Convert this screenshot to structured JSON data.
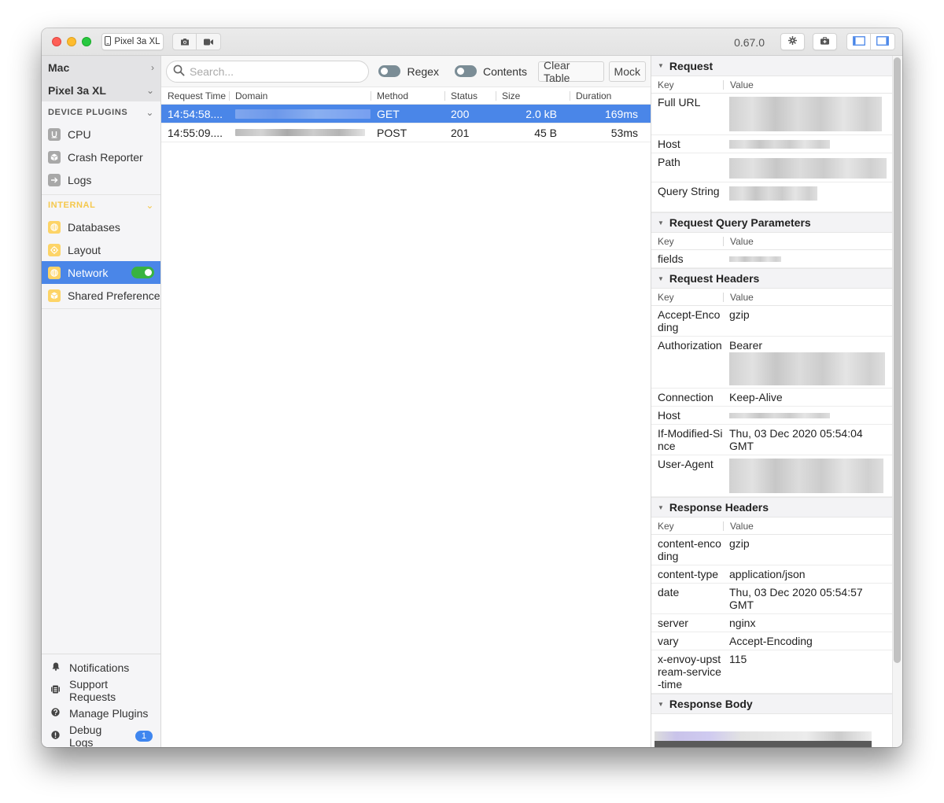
{
  "titlebar": {
    "device_button_label": "Pixel 3a XL",
    "version": "0.67.0"
  },
  "sidebar": {
    "devices": [
      {
        "label": "Mac",
        "chevron": ">"
      },
      {
        "label": "Pixel 3a XL",
        "chevron": "v"
      }
    ],
    "device_plugins": {
      "title": "DEVICE PLUGINS",
      "items": [
        {
          "label": "CPU",
          "icon": "cpu-icon"
        },
        {
          "label": "Crash Reporter",
          "icon": "cube-icon"
        },
        {
          "label": "Logs",
          "icon": "arrow-right-icon"
        }
      ]
    },
    "internal": {
      "title": "INTERNAL",
      "accent_color": "#f5c84c",
      "items": [
        {
          "label": "Databases",
          "icon": "globe-icon"
        },
        {
          "label": "Layout",
          "icon": "target-icon"
        },
        {
          "label": "Network",
          "icon": "globe-icon",
          "active": true,
          "toggle": "on"
        },
        {
          "label": "Shared Preferences",
          "icon": "cube-icon"
        }
      ]
    },
    "bottom": [
      {
        "label": "Notifications",
        "icon": "bell-icon"
      },
      {
        "label": "Support Requests",
        "icon": "clipboard-icon"
      },
      {
        "label": "Manage Plugins",
        "icon": "question-icon"
      },
      {
        "label": "Debug Logs",
        "icon": "exclamation-icon",
        "badge": "1"
      }
    ]
  },
  "toolbar": {
    "search_placeholder": "Search...",
    "regex_label": "Regex",
    "contents_label": "Contents",
    "clear_label": "Clear Table",
    "mock_label": "Mock"
  },
  "table": {
    "columns": [
      "Request Time",
      "Domain",
      "Method",
      "Status",
      "Size",
      "Duration"
    ],
    "rows": [
      {
        "time": "14:54:58....",
        "domain": "[redacted]",
        "method": "GET",
        "status": "200",
        "size": "2.0 kB",
        "duration": "169ms",
        "selected": true
      },
      {
        "time": "14:55:09....",
        "domain": "[redacted]",
        "method": "POST",
        "status": "201",
        "size": "45 B",
        "duration": "53ms",
        "selected": false
      }
    ]
  },
  "detail": {
    "key_label": "Key",
    "value_label": "Value",
    "request": {
      "title": "Request",
      "rows": [
        {
          "key": "Full URL",
          "value": ""
        },
        {
          "key": "Host",
          "value": ""
        },
        {
          "key": "Path",
          "value": ""
        },
        {
          "key": "Query String",
          "value": ""
        }
      ]
    },
    "query_params": {
      "title": "Request Query Parameters",
      "rows": [
        {
          "key": "fields",
          "value": ""
        }
      ]
    },
    "request_headers": {
      "title": "Request Headers",
      "rows": [
        {
          "key": "Accept-Encoding",
          "value": "gzip"
        },
        {
          "key": "Authorization",
          "value": "Bearer"
        },
        {
          "key": "Connection",
          "value": "Keep-Alive"
        },
        {
          "key": "Host",
          "value": ""
        },
        {
          "key": "If-Modified-Since",
          "value": "Thu, 03 Dec 2020 05:54:04 GMT"
        },
        {
          "key": "User-Agent",
          "value": ""
        }
      ]
    },
    "response_headers": {
      "title": "Response Headers",
      "rows": [
        {
          "key": "content-encoding",
          "value": "gzip"
        },
        {
          "key": "content-type",
          "value": "application/json"
        },
        {
          "key": "date",
          "value": "Thu, 03 Dec 2020 05:54:57 GMT"
        },
        {
          "key": "server",
          "value": "nginx"
        },
        {
          "key": "vary",
          "value": "Accept-Encoding"
        },
        {
          "key": "x-envoy-upstream-service-time",
          "value": "115"
        }
      ]
    },
    "response_body": {
      "title": "Response Body"
    }
  },
  "colors": {
    "selection": "#4a86e8",
    "toggle_on": "#38b341",
    "badge": "#3f86ef"
  }
}
